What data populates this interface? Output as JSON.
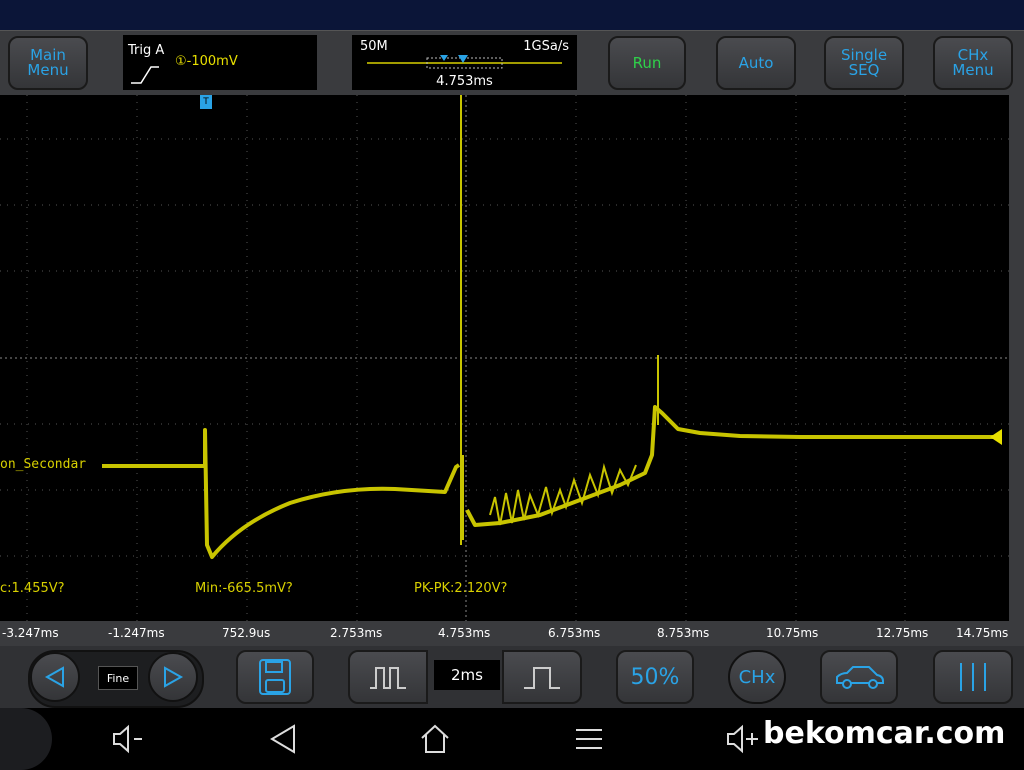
{
  "toolbar": {
    "main_menu": "Main Menu",
    "trigger": {
      "title": "Trig A",
      "level": "①-100mV"
    },
    "timebase": {
      "memory": "50M",
      "sample_rate": "1GSa/s",
      "position": "4.753ms"
    },
    "run": "Run",
    "auto": "Auto",
    "single_seq": "Single SEQ",
    "chx_menu": "CHx Menu"
  },
  "screen": {
    "channel_label": "on_Secondar",
    "measurements": {
      "max": "c:1.455V?",
      "min": "Min:-665.5mV?",
      "pkpk": "PK-PK:2.120V?"
    },
    "trigger_marker": "T"
  },
  "time_axis": [
    "-3.247ms",
    "-1.247ms",
    "752.9us",
    "2.753ms",
    "4.753ms",
    "6.753ms",
    "8.753ms",
    "10.75ms",
    "12.75ms",
    "14.75ms"
  ],
  "controls": {
    "step_mode": "Fine",
    "time_div": "2ms",
    "fifty_percent": "50%",
    "chx": "CHx"
  },
  "watermark": "bekomcar.com",
  "colors": {
    "trace": "#c8c400",
    "accent": "#2aa3e6",
    "run": "#2fd04a"
  }
}
